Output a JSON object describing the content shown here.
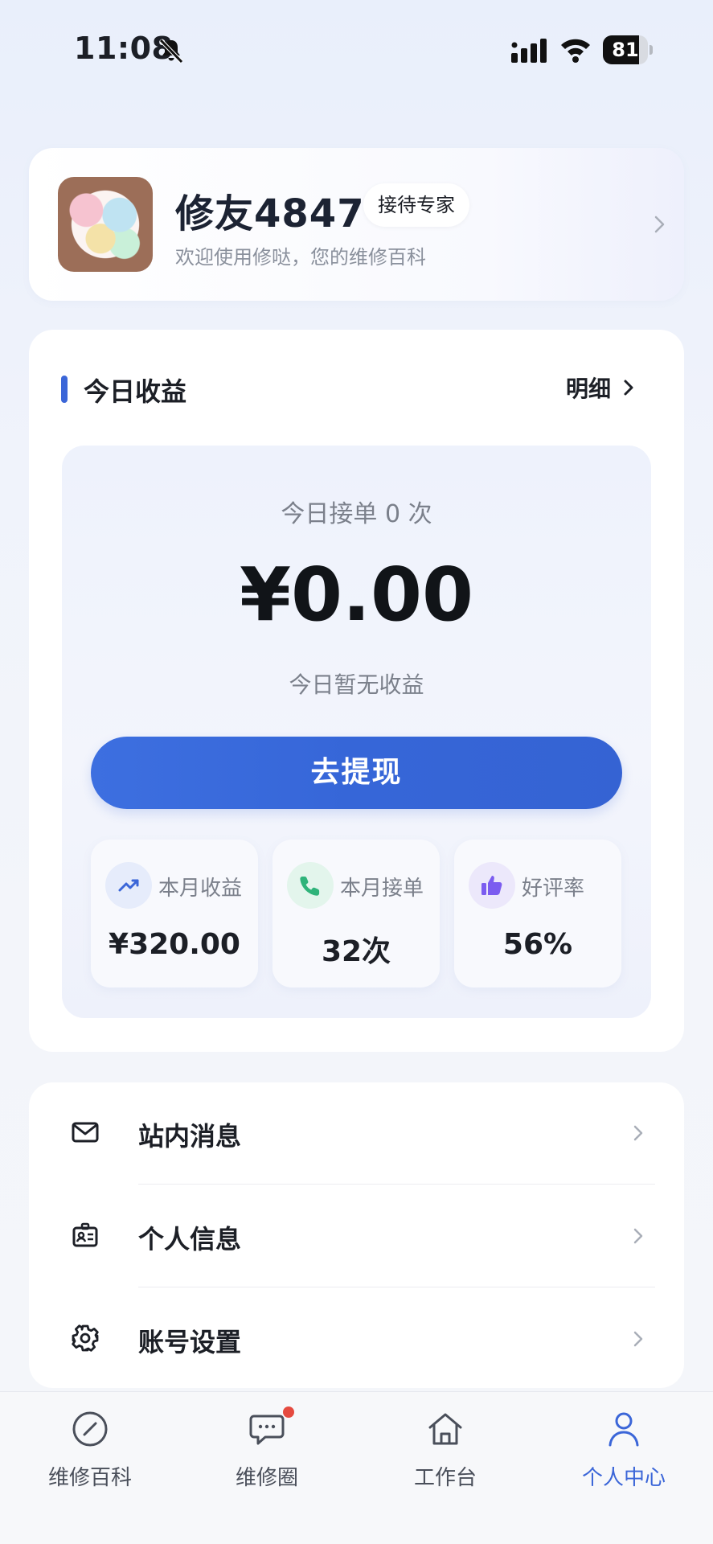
{
  "status_bar": {
    "time": "11:08",
    "battery_level": "81",
    "battery_fraction": 0.81
  },
  "profile": {
    "username": "修友4847",
    "role_badge": "接待专家",
    "welcome": "欢迎使用修哒，您的维修百科"
  },
  "earnings": {
    "title": "今日收益",
    "detail_link": "明细",
    "orders_today": "今日接单 0 次",
    "amount_today": "¥0.00",
    "no_income": "今日暂无收益",
    "withdraw_button": "去提现",
    "stats": [
      {
        "icon": "trend-up-icon",
        "label": "本月收益",
        "value": "¥320.00",
        "color": "#3b66d8"
      },
      {
        "icon": "phone-icon",
        "label": "本月接单",
        "value": "32次",
        "color": "#2fb37a"
      },
      {
        "icon": "thumbs-up-icon",
        "label": "好评率",
        "value": "56%",
        "color": "#7b5cf0"
      }
    ]
  },
  "menu": {
    "items": [
      {
        "icon": "mail-icon",
        "label": "站内消息"
      },
      {
        "icon": "id-card-icon",
        "label": "个人信息"
      },
      {
        "icon": "gear-icon",
        "label": "账号设置"
      }
    ]
  },
  "tab_bar": {
    "tabs": [
      {
        "icon": "compass-icon",
        "label": "维修百科"
      },
      {
        "icon": "chat-bubble-icon",
        "label": "维修圈",
        "has_badge": true
      },
      {
        "icon": "home-icon",
        "label": "工作台"
      },
      {
        "icon": "person-icon",
        "label": "个人中心",
        "active": true
      }
    ]
  },
  "colors": {
    "accent": "#3b66d8",
    "badge_dot": "#e54a3f"
  }
}
